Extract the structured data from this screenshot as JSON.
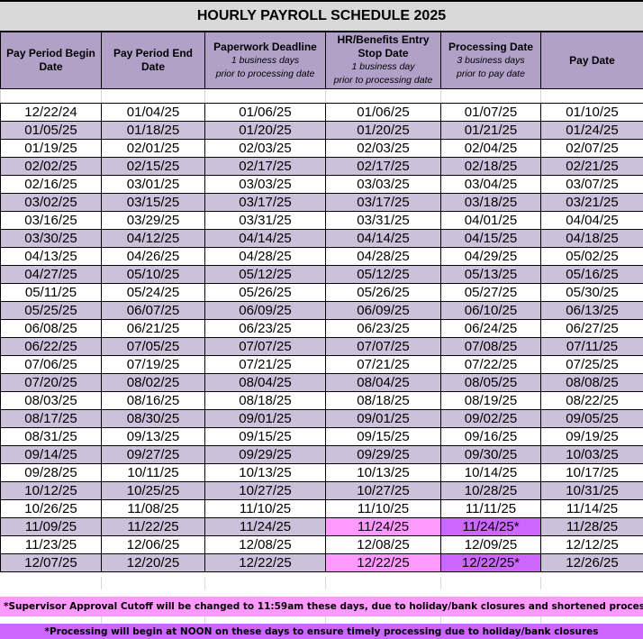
{
  "title": "HOURLY PAYROLL SCHEDULE 2025",
  "columns": [
    {
      "label": "Pay Period Begin Date",
      "sub1": "",
      "sub2": ""
    },
    {
      "label": "Pay Period End Date",
      "sub1": "",
      "sub2": ""
    },
    {
      "label": "Paperwork Deadline",
      "sub1": "1 business days",
      "sub2": "prior to processing date"
    },
    {
      "label": "HR/Benefits Entry Stop Date",
      "sub1": "1 business day",
      "sub2": "prior to processing date"
    },
    {
      "label": "Processing Date",
      "sub1": "3 business days",
      "sub2": "prior to pay date"
    },
    {
      "label": "Pay Date",
      "sub1": "",
      "sub2": ""
    }
  ],
  "rows": [
    [
      "12/22/24",
      "01/04/25",
      "01/06/25",
      "01/06/25",
      "01/07/25",
      "01/10/25"
    ],
    [
      "01/05/25",
      "01/18/25",
      "01/20/25",
      "01/20/25",
      "01/21/25",
      "01/24/25"
    ],
    [
      "01/19/25",
      "02/01/25",
      "02/03/25",
      "02/03/25",
      "02/04/25",
      "02/07/25"
    ],
    [
      "02/02/25",
      "02/15/25",
      "02/17/25",
      "02/17/25",
      "02/18/25",
      "02/21/25"
    ],
    [
      "02/16/25",
      "03/01/25",
      "03/03/25",
      "03/03/25",
      "03/04/25",
      "03/07/25"
    ],
    [
      "03/02/25",
      "03/15/25",
      "03/17/25",
      "03/17/25",
      "03/18/25",
      "03/21/25"
    ],
    [
      "03/16/25",
      "03/29/25",
      "03/31/25",
      "03/31/25",
      "04/01/25",
      "04/04/25"
    ],
    [
      "03/30/25",
      "04/12/25",
      "04/14/25",
      "04/14/25",
      "04/15/25",
      "04/18/25"
    ],
    [
      "04/13/25",
      "04/26/25",
      "04/28/25",
      "04/28/25",
      "04/29/25",
      "05/02/25"
    ],
    [
      "04/27/25",
      "05/10/25",
      "05/12/25",
      "05/12/25",
      "05/13/25",
      "05/16/25"
    ],
    [
      "05/11/25",
      "05/24/25",
      "05/26/25",
      "05/26/25",
      "05/27/25",
      "05/30/25"
    ],
    [
      "05/25/25",
      "06/07/25",
      "06/09/25",
      "06/09/25",
      "06/10/25",
      "06/13/25"
    ],
    [
      "06/08/25",
      "06/21/25",
      "06/23/25",
      "06/23/25",
      "06/24/25",
      "06/27/25"
    ],
    [
      "06/22/25",
      "07/05/25",
      "07/07/25",
      "07/07/25",
      "07/08/25",
      "07/11/25"
    ],
    [
      "07/06/25",
      "07/19/25",
      "07/21/25",
      "07/21/25",
      "07/22/25",
      "07/25/25"
    ],
    [
      "07/20/25",
      "08/02/25",
      "08/04/25",
      "08/04/25",
      "08/05/25",
      "08/08/25"
    ],
    [
      "08/03/25",
      "08/16/25",
      "08/18/25",
      "08/18/25",
      "08/19/25",
      "08/22/25"
    ],
    [
      "08/17/25",
      "08/30/25",
      "09/01/25",
      "09/01/25",
      "09/02/25",
      "09/05/25"
    ],
    [
      "08/31/25",
      "09/13/25",
      "09/15/25",
      "09/15/25",
      "09/16/25",
      "09/19/25"
    ],
    [
      "09/14/25",
      "09/27/25",
      "09/29/25",
      "09/29/25",
      "09/30/25",
      "10/03/25"
    ],
    [
      "09/28/25",
      "10/11/25",
      "10/13/25",
      "10/13/25",
      "10/14/25",
      "10/17/25"
    ],
    [
      "10/12/25",
      "10/25/25",
      "10/27/25",
      "10/27/25",
      "10/28/25",
      "10/31/25"
    ],
    [
      "10/26/25",
      "11/08/25",
      "11/10/25",
      "11/10/25",
      "11/11/25",
      "11/14/25"
    ],
    [
      "11/09/25",
      "11/22/25",
      "11/24/25",
      "11/24/25",
      "11/24/25*",
      "11/28/25"
    ],
    [
      "11/23/25",
      "12/06/25",
      "12/08/25",
      "12/08/25",
      "12/09/25",
      "12/12/25"
    ],
    [
      "12/07/25",
      "12/20/25",
      "12/22/25",
      "12/22/25",
      "12/22/25*",
      "12/26/25"
    ]
  ],
  "highlights": [
    {
      "row": 23,
      "col": 3,
      "color": "#ff99ff"
    },
    {
      "row": 23,
      "col": 4,
      "color": "#cc66ff"
    },
    {
      "row": 25,
      "col": 3,
      "color": "#ff99ff"
    },
    {
      "row": 25,
      "col": 4,
      "color": "#cc66ff"
    }
  ],
  "colors": {
    "header_bg": "#b1a0c7",
    "alt_row_bg": "#ccc0da",
    "title_bg": "#d9d9d9",
    "pink": "#ff99ff",
    "violet": "#cc66ff"
  },
  "notes": {
    "supervisor_cutoff": "*Supervisor Approval Cutoff will be changed to 11:59am these days, due to holiday/bank closures and shortened processing time",
    "processing_noon": "*Processing will begin at NOON on these days to ensure timely processing due to holiday/bank closures"
  }
}
